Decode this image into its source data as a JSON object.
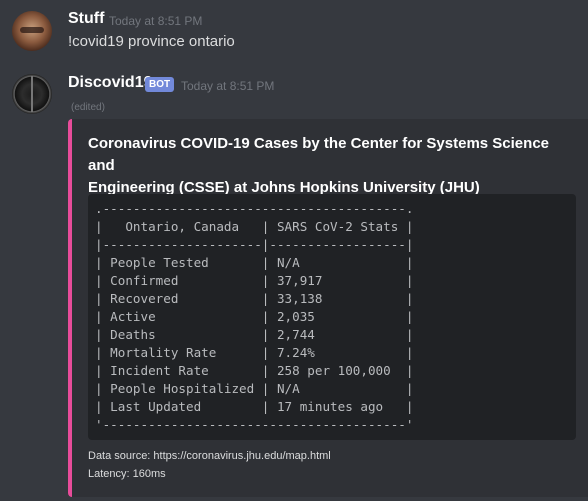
{
  "messages": [
    {
      "username": "Stuff",
      "timestamp": "Today at 8:51 PM",
      "content": "!covid19 province ontario"
    },
    {
      "username": "Discovid19",
      "badge": "BOT",
      "timestamp": "Today at 8:51 PM",
      "edited": "(edited)",
      "embed": {
        "accent_color": "#e84c9a",
        "title_line1": "Coronavirus COVID-19 Cases by the Center for Systems Science and",
        "title_line2": "Engineering (CSSE) at Johns Hopkins University (JHU)",
        "table": {
          "header_left": "Ontario, Canada",
          "header_right": "SARS CoV-2 Stats",
          "rows": [
            {
              "label": "People Tested",
              "value": "N/A"
            },
            {
              "label": "Confirmed",
              "value": "37,917"
            },
            {
              "label": "Recovered",
              "value": "33,138"
            },
            {
              "label": "Active",
              "value": "2,035"
            },
            {
              "label": "Deaths",
              "value": "2,744"
            },
            {
              "label": "Mortality Rate",
              "value": "7.24%"
            },
            {
              "label": "Incident Rate",
              "value": "258 per 100,000"
            },
            {
              "label": "People Hospitalized",
              "value": "N/A"
            },
            {
              "label": "Last Updated",
              "value": "17 minutes ago"
            }
          ]
        },
        "footer_source": "Data source: https://coronavirus.jhu.edu/map.html",
        "footer_latency": "Latency: 160ms"
      }
    }
  ],
  "icons": {
    "user_avatar": "user-avatar",
    "bot_avatar": "virus-avatar"
  }
}
